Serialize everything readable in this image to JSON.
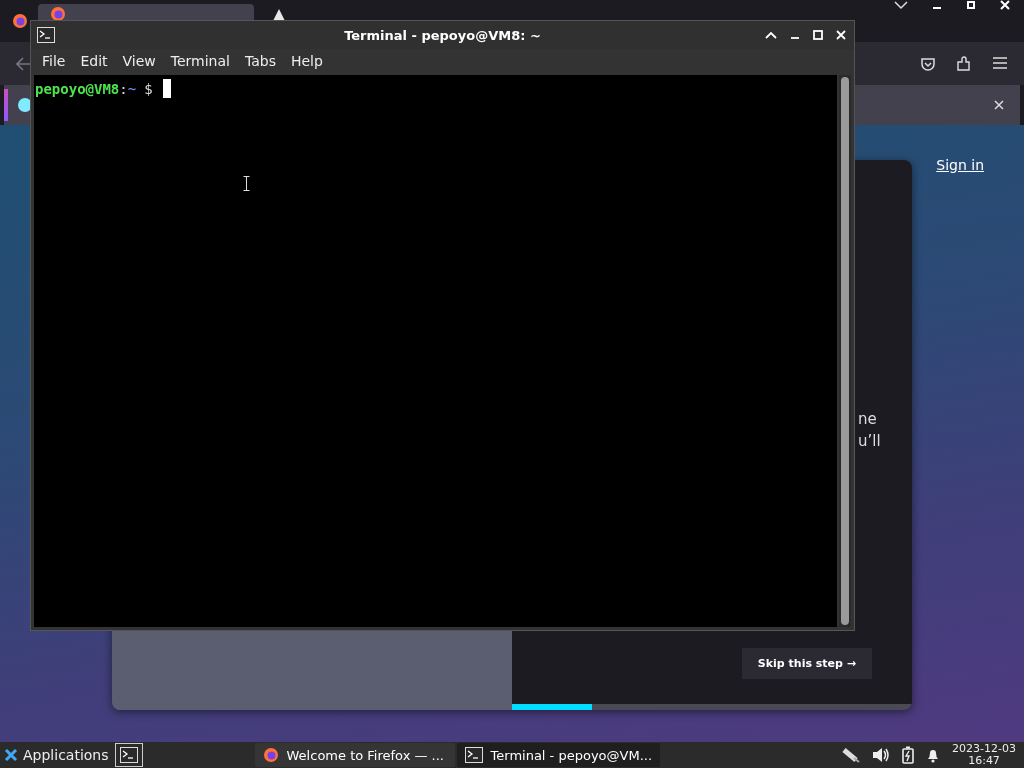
{
  "browser": {
    "tabs": [
      {
        "selected": true
      },
      {
        "selected": false
      }
    ],
    "page": {
      "sign_in": "Sign in",
      "fragments": [
        "ne",
        "u’ll"
      ],
      "skip_button": "Skip this step →",
      "progress": {
        "level": 0.2
      }
    }
  },
  "terminal": {
    "title": "Terminal - pepoyo@VM8: ~",
    "menu": [
      "File",
      "Edit",
      "View",
      "Terminal",
      "Tabs",
      "Help"
    ],
    "prompt": {
      "user_host": "pepoyo@VM8",
      "separator": ":",
      "path": "~",
      "symbol": "$"
    }
  },
  "taskbar": {
    "applications": "Applications",
    "tasks": [
      {
        "title": "Welcome to Firefox — ...",
        "selected": false
      },
      {
        "title": "Terminal - pepoyo@VM...",
        "selected": true
      }
    ],
    "date": "2023-12-03",
    "time": "16:47"
  }
}
